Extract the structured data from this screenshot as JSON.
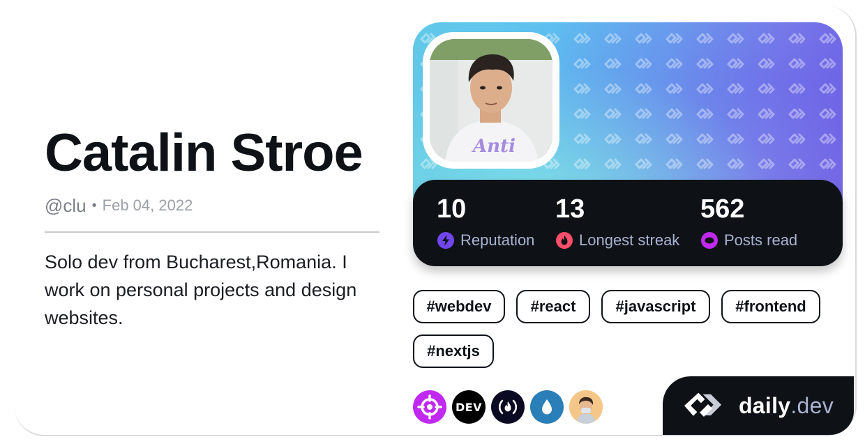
{
  "profile": {
    "name": "Catalin Stroe",
    "handle": "@clu",
    "separator": "•",
    "joined": "Feb 04, 2022",
    "bio": "Solo dev from Bucharest,Romania. I work on personal projects and design websites."
  },
  "stats": [
    {
      "value": "10",
      "label": "Reputation",
      "icon": "lightning-icon",
      "color": "#7147ed"
    },
    {
      "value": "13",
      "label": "Longest streak",
      "icon": "flame-icon",
      "color": "#ff4f6a"
    },
    {
      "value": "562",
      "label": "Posts read",
      "icon": "ring-icon",
      "color": "#c029f0"
    }
  ],
  "tags": [
    "#webdev",
    "#react",
    "#javascript",
    "#frontend",
    "#nextjs"
  ],
  "sources": [
    {
      "icon": "crosshair-icon",
      "color": "#c029f0"
    },
    {
      "icon": "dev-logo-icon",
      "text": "DEV",
      "color": "#000000"
    },
    {
      "icon": "freecodecamp-icon",
      "text": "(🔥)",
      "color": "#0a0a23"
    },
    {
      "icon": "drop-icon",
      "color": "#2a7fb8"
    },
    {
      "icon": "avatar-icon",
      "color": "#f2c07a"
    }
  ],
  "brand": {
    "name": "daily",
    "suffix": ".dev"
  },
  "colors": {
    "accent": "#0e1217",
    "muted": "#a8b3cf"
  }
}
